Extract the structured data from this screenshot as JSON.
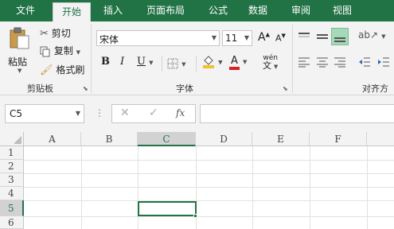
{
  "tabs": [
    {
      "label": "文件"
    },
    {
      "label": "开始"
    },
    {
      "label": "插入"
    },
    {
      "label": "页面布局"
    },
    {
      "label": "公式"
    },
    {
      "label": "数据"
    },
    {
      "label": "审阅"
    },
    {
      "label": "视图"
    }
  ],
  "active_tab": "开始",
  "clipboard": {
    "paste_label": "粘贴",
    "cut_label": "剪切",
    "copy_label": "复制",
    "format_painter_label": "格式刷",
    "group_label": "剪贴板"
  },
  "font": {
    "font_name": "宋体",
    "font_size": "11",
    "bold": "B",
    "italic": "I",
    "underline": "U",
    "increase_size": "A",
    "decrease_size": "A",
    "font_color_letter": "A",
    "phonetic_label": "wén",
    "group_label": "字体"
  },
  "alignment": {
    "group_label": "对齐方式"
  },
  "formula_bar": {
    "name_box": "C5",
    "fx_label": "fx",
    "formula_value": ""
  },
  "grid": {
    "columns": [
      "A",
      "B",
      "C",
      "D",
      "E",
      "F"
    ],
    "rows": [
      "1",
      "2",
      "3",
      "4",
      "5",
      "6"
    ],
    "selected_column": "C",
    "selected_row": "5"
  },
  "colors": {
    "accent": "#217346",
    "highlight": "#f2c12e",
    "font_color": "#d62424"
  }
}
